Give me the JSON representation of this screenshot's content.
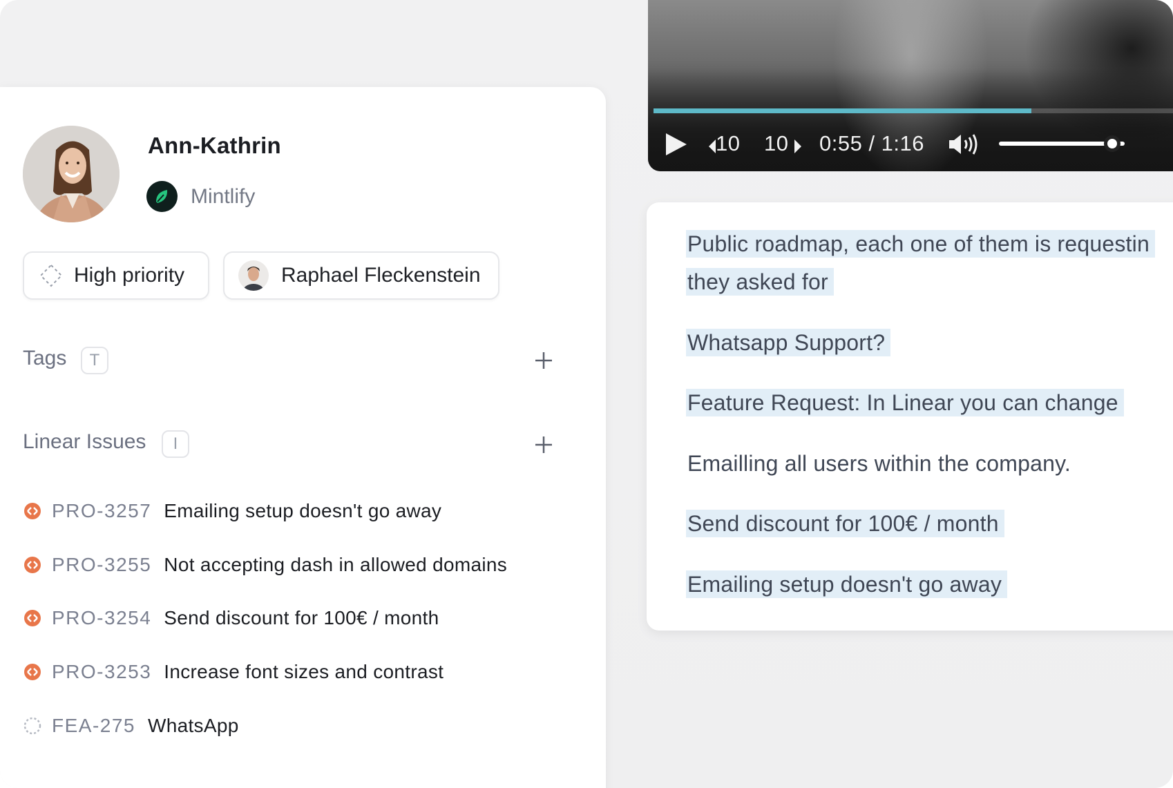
{
  "profile": {
    "name": "Ann-Kathrin",
    "company": "Mintlify"
  },
  "chips": {
    "priority": "High priority",
    "assignee": "Raphael Fleckenstein"
  },
  "tags": {
    "label": "Tags",
    "shortcut": "T"
  },
  "issues": {
    "label": "Linear Issues",
    "shortcut": "I",
    "items": [
      {
        "id": "PRO-3257",
        "title": "Emailing setup doesn't go away",
        "status": "urgent"
      },
      {
        "id": "PRO-3255",
        "title": "Not accepting dash in allowed domains",
        "status": "urgent"
      },
      {
        "id": "PRO-3254",
        "title": "Send discount for 100€ / month",
        "status": "urgent"
      },
      {
        "id": "PRO-3253",
        "title": "Increase font sizes and contrast",
        "status": "urgent"
      },
      {
        "id": "FEA-275",
        "title": "WhatsApp",
        "status": "backlog"
      }
    ]
  },
  "video": {
    "rewind": "10",
    "forward": "10",
    "time": "0:55 / 1:16",
    "progress": 0.72,
    "volume": 0.9,
    "progress_color": "#5eb9c8"
  },
  "transcript": {
    "lines": [
      {
        "text": "Public roadmap, each one of them is requestin",
        "highlight": true
      },
      {
        "text": "they asked for",
        "highlight": true
      },
      {
        "text": "Whatsapp Support?",
        "highlight": true
      },
      {
        "text": "Feature Request: In Linear you can change",
        "highlight": true
      },
      {
        "text": "Emailling all users within the company.",
        "highlight": false
      },
      {
        "text": "Send discount for 100€ / month",
        "highlight": true
      },
      {
        "text": "Emailing setup doesn't go away",
        "highlight": true
      }
    ],
    "highlight_color": "#e2eef7"
  },
  "colors": {
    "urgent": "#e8764a",
    "text_primary": "#1b1d22",
    "text_muted": "#737885"
  }
}
